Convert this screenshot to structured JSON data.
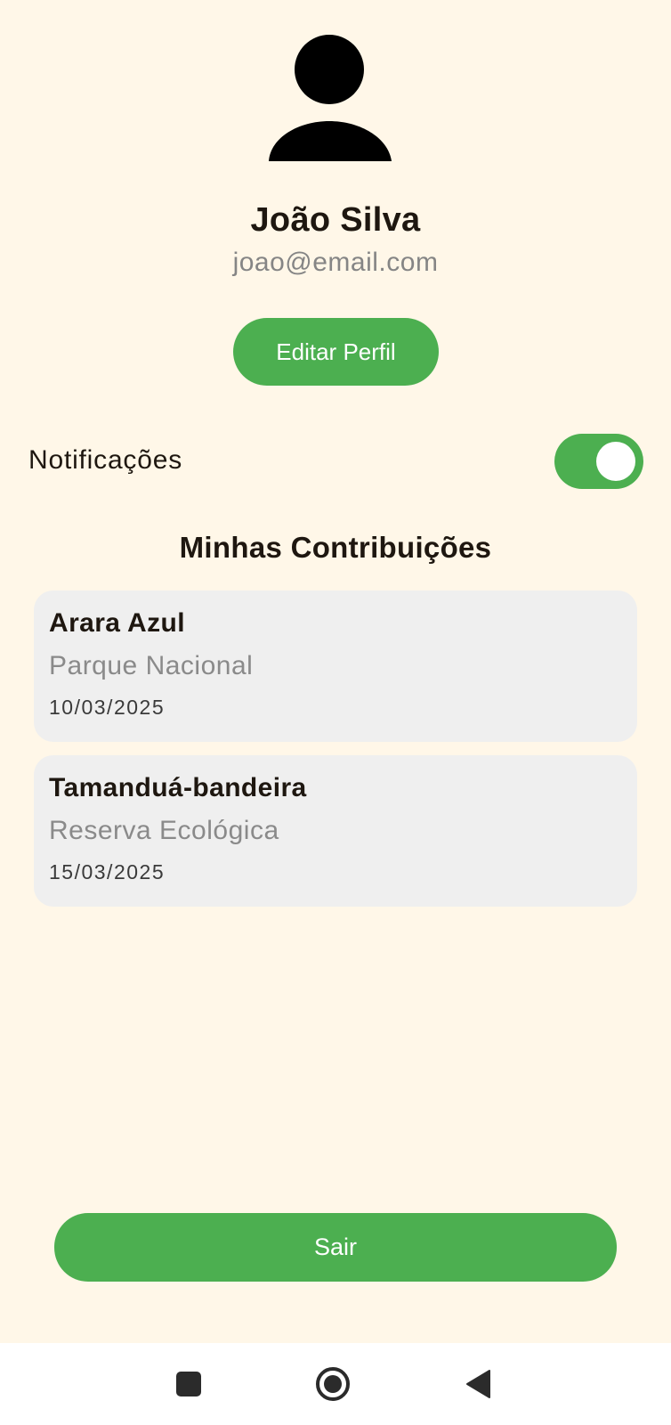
{
  "profile": {
    "name": "João Silva",
    "email": "joao@email.com",
    "edit_label": "Editar Perfil",
    "avatar_icon": "person-icon"
  },
  "settings": {
    "notifications_label": "Notificações",
    "notifications_enabled": true
  },
  "contributions": {
    "title": "Minhas Contribuições",
    "items": [
      {
        "species": "Arara Azul",
        "location": "Parque Nacional",
        "date": "10/03/2025"
      },
      {
        "species": "Tamanduá-bandeira",
        "location": "Reserva Ecológica",
        "date": "15/03/2025"
      }
    ]
  },
  "logout_label": "Sair",
  "colors": {
    "accent": "#4CAF50",
    "background": "#FFF7E8",
    "card": "#EFEFEF",
    "text": "#1E1710",
    "muted": "#858585"
  },
  "navbar": {
    "icons": [
      "recents-square-icon",
      "home-circle-icon",
      "back-triangle-icon"
    ]
  }
}
